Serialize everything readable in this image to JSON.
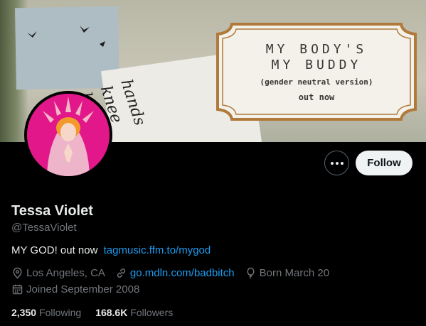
{
  "banner": {
    "handwriting": [
      "hands",
      "knee",
      "bod"
    ],
    "label_line1": "MY BODY'S",
    "label_line2": "MY BUDDY",
    "label_sub": "(gender neutral version)",
    "label_out": "out now"
  },
  "profile": {
    "name": "Tessa Violet",
    "handle": "@TessaViolet",
    "bio_text": "MY GOD! out now",
    "bio_link": "tagmusic.ffm.to/mygod",
    "location": "Los Angeles, CA",
    "website": "go.mdln.com/badbitch",
    "birthday": "Born March 20",
    "joined": "Joined September 2008",
    "following_count": "2,350",
    "following_label": "Following",
    "followers_count": "168.6K",
    "followers_label": "Followers"
  },
  "actions": {
    "follow_label": "Follow"
  },
  "colors": {
    "link": "#1d9bf0",
    "muted": "#71767b",
    "avatar_bg": "#e2178a"
  }
}
